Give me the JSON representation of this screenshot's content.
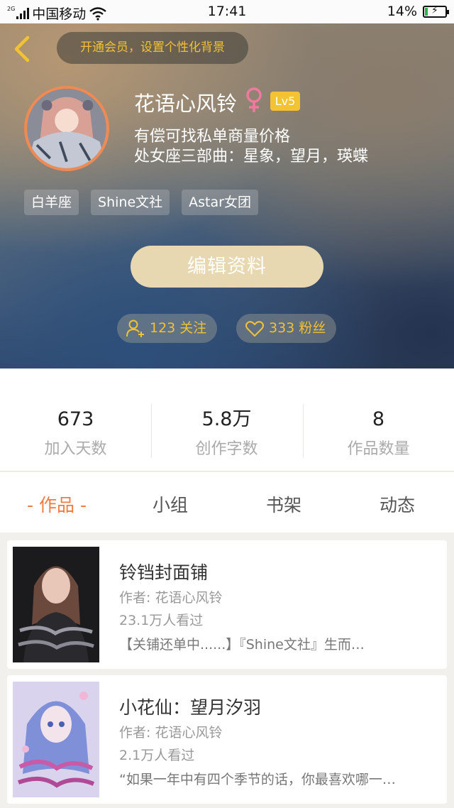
{
  "status_bar": {
    "network": "2G",
    "carrier": "中国移动",
    "time": "17:41",
    "battery": "14%",
    "battery_level": 0.14
  },
  "header": {
    "back_icon": "chevron-left-icon",
    "vip_prompt": "开通会员，设置个性化背景",
    "username": "花语心风铃",
    "gender_icon": "female-icon",
    "level": "Lv5",
    "bio_lines": [
      "有偿可找私单商量价格",
      "处女座三部曲：星象，望月，瑛蝶"
    ],
    "tags": [
      "白羊座",
      "Shine文社",
      "Astar女团"
    ],
    "edit_button": "编辑资料",
    "following": "123 关注",
    "followers": "333 粉丝"
  },
  "stats": [
    {
      "value": "673",
      "label": "加入天数"
    },
    {
      "value": "5.8万",
      "label": "创作字数"
    },
    {
      "value": "8",
      "label": "作品数量"
    }
  ],
  "tabs": [
    "- 作品 -",
    "小组",
    "书架",
    "动态"
  ],
  "active_tab": 0,
  "works": [
    {
      "title": "铃铛封面铺",
      "author": "作者: 花语心风铃",
      "views": "23.1万人看过",
      "desc": "【关铺还单中......】『Shine文社』生而…"
    },
    {
      "title": "小花仙：望月汐羽",
      "author": "作者: 花语心风铃",
      "views": "2.1万人看过",
      "desc": "“如果一年中有四个季节的话，你最喜欢哪一…"
    }
  ],
  "colors": {
    "accent": "#f07b3e",
    "gold": "#f1c231",
    "level_badge": "#f4c331",
    "edit_button": "#e7d8b1"
  }
}
